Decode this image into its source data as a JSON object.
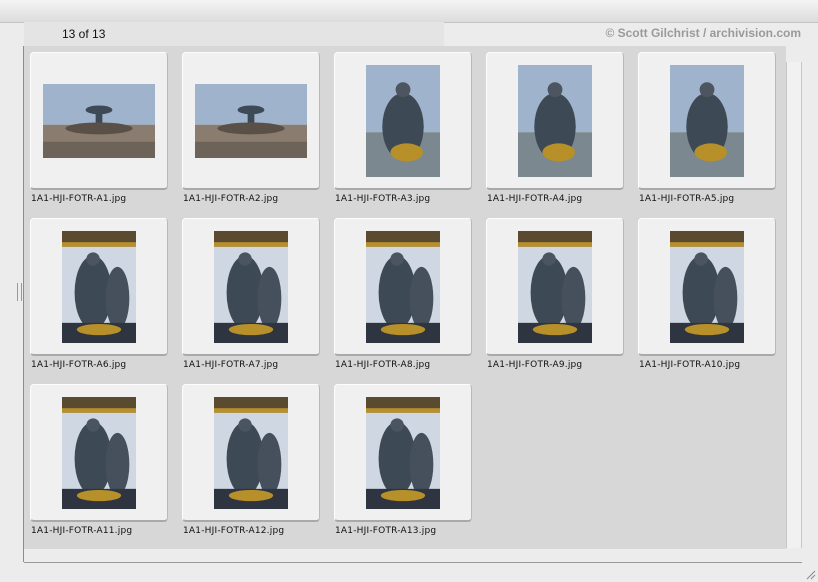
{
  "header": {
    "count_text": "13 of 13",
    "credit_text": "© Scott Gilchrist / archivision.com"
  },
  "thumbnails": [
    {
      "filename": "1A1-HJI-FOTR-A1.jpg",
      "orientation": "landscape",
      "subject": "fountain-wide-view"
    },
    {
      "filename": "1A1-HJI-FOTR-A2.jpg",
      "orientation": "landscape",
      "subject": "fountain-wide-view"
    },
    {
      "filename": "1A1-HJI-FOTR-A3.jpg",
      "orientation": "portrait",
      "subject": "triton-statue-sky"
    },
    {
      "filename": "1A1-HJI-FOTR-A4.jpg",
      "orientation": "portrait",
      "subject": "triton-statue-sky"
    },
    {
      "filename": "1A1-HJI-FOTR-A5.jpg",
      "orientation": "portrait",
      "subject": "triton-statue-sky"
    },
    {
      "filename": "1A1-HJI-FOTR-A6.jpg",
      "orientation": "portrait",
      "subject": "fountain-statues"
    },
    {
      "filename": "1A1-HJI-FOTR-A7.jpg",
      "orientation": "portrait",
      "subject": "fountain-statues"
    },
    {
      "filename": "1A1-HJI-FOTR-A8.jpg",
      "orientation": "portrait",
      "subject": "fountain-statues"
    },
    {
      "filename": "1A1-HJI-FOTR-A9.jpg",
      "orientation": "portrait",
      "subject": "fountain-statues"
    },
    {
      "filename": "1A1-HJI-FOTR-A10.jpg",
      "orientation": "portrait",
      "subject": "fountain-statues"
    },
    {
      "filename": "1A1-HJI-FOTR-A11.jpg",
      "orientation": "portrait",
      "subject": "fountain-statues"
    },
    {
      "filename": "1A1-HJI-FOTR-A12.jpg",
      "orientation": "portrait",
      "subject": "fountain-statues"
    },
    {
      "filename": "1A1-HJI-FOTR-A13.jpg",
      "orientation": "portrait",
      "subject": "fountain-statues"
    }
  ],
  "colors": {
    "panel_bg": "#d7d7d7",
    "tile_bg": "#f0f0f0",
    "credit_text": "#9a9a9a",
    "sky": "#9fb4cc",
    "bronze": "#3d4a55",
    "gold": "#b8902a",
    "stone": "#8a7d70"
  }
}
